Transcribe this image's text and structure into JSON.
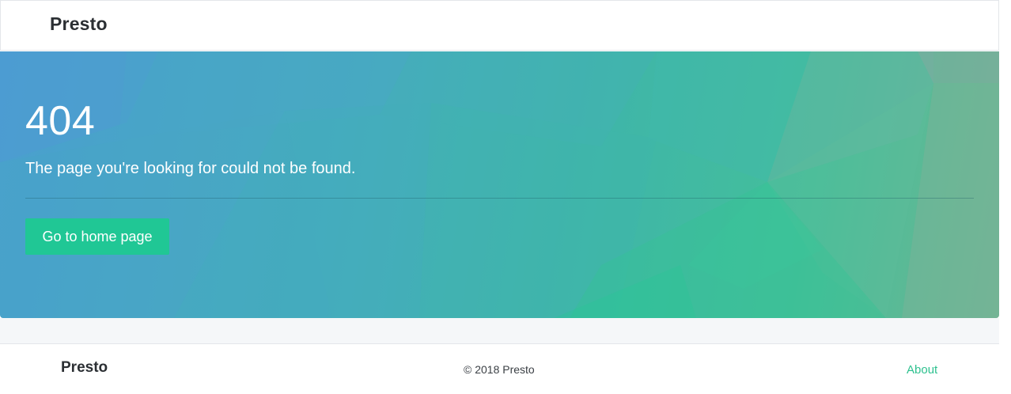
{
  "navbar": {
    "brand": "Presto"
  },
  "hero": {
    "error_code": "404",
    "message": "The page you're looking for could not be found.",
    "home_button_label": "Go to home page"
  },
  "footer": {
    "brand": "Presto",
    "copyright": "© 2018 Presto",
    "about_label": "About"
  },
  "colors": {
    "accent": "#20c795",
    "link": "#2ec18f",
    "hero_gradient_start": "#4a9fcf",
    "hero_gradient_end": "#6fb493",
    "text_dark": "#2b2f33"
  }
}
